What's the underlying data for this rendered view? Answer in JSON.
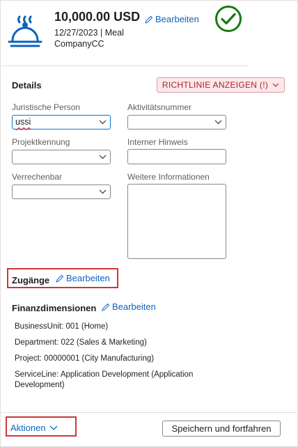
{
  "expense": {
    "amount": "10,000.00 USD",
    "edit_label": "Bearbeiten",
    "date_category": "12/27/2023 | Meal",
    "payment_method": "CompanyCC",
    "status_icon": "check-circle-icon",
    "category_icon": "meal-cloche-icon"
  },
  "details": {
    "title": "Details",
    "policy_button": "RICHTLINIE ANZEIGEN (!)",
    "fields": {
      "legal_entity": {
        "label": "Juristische Person",
        "value": "ussi"
      },
      "activity_number": {
        "label": "Aktivitätsnummer",
        "value": ""
      },
      "project_id": {
        "label": "Projektkennung",
        "value": ""
      },
      "internal_note": {
        "label": "Interner Hinweis",
        "value": ""
      },
      "billable": {
        "label": "Verrechenbar",
        "value": ""
      },
      "more_info": {
        "label": "Weitere Informationen",
        "value": ""
      }
    }
  },
  "zugaenge": {
    "title": "Zugänge",
    "edit_label": "Bearbeiten"
  },
  "financial": {
    "title": "Finanzdimensionen",
    "edit_label": "Bearbeiten",
    "dimensions": [
      "BusinessUnit: 001 (Home)",
      "Department: 022 (Sales & Marketing)",
      "Project: 00000001 (City Manufacturing)",
      "ServiceLine: Application Development (Application Development)"
    ]
  },
  "footer": {
    "actions_label": "Aktionen",
    "save_button": "Speichern und fortfahren"
  },
  "colors": {
    "accent": "#0f62be",
    "success": "#107c10",
    "warning": "#a4262c",
    "highlight": "#d13438"
  }
}
